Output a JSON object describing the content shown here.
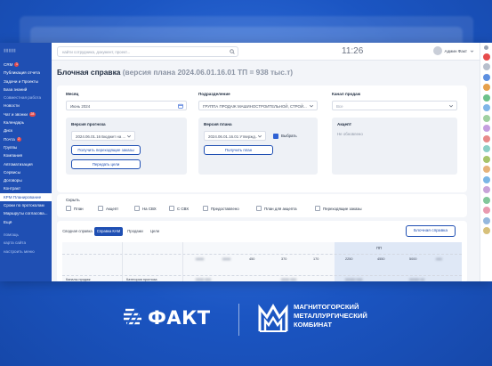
{
  "topbar": {
    "search_placeholder": "найти сотрудника, документ, проект...",
    "clock": "11:26",
    "user_name": "Админ Факт"
  },
  "sidebar": {
    "items": [
      {
        "label": "CRM",
        "badge": "1"
      },
      {
        "label": "Публикация отчета"
      },
      {
        "label": "Задачи и Проекты"
      },
      {
        "label": "База знаний"
      },
      {
        "label": "Совместная работа"
      },
      {
        "label": "Новости"
      },
      {
        "label": "Чат и звонки",
        "badge": "28"
      },
      {
        "label": "Календарь"
      },
      {
        "label": "Диск"
      },
      {
        "label": "Почта",
        "badge": "2"
      },
      {
        "label": "Группы"
      },
      {
        "label": "Компания"
      },
      {
        "label": "Автоматизация"
      },
      {
        "label": "Сервисы"
      },
      {
        "label": "Договоры"
      },
      {
        "label": "Контракт"
      },
      {
        "label": "КРМ Планирование"
      },
      {
        "label": "Сроки по протоколам"
      },
      {
        "label": "Маршруты согласова..."
      },
      {
        "label": "Ещё"
      },
      {
        "label": "помощь"
      },
      {
        "label": "карта сайта"
      },
      {
        "label": "настроить меню"
      }
    ]
  },
  "page": {
    "title": "Блочная справка",
    "subtitle": "(версия плана 2024.06.01.16.01 ТП = 938 тыс.т)"
  },
  "filters": {
    "month_label": "Месяц",
    "month_value": "Июнь 2024",
    "division_label": "Подразделение",
    "division_value": "ГРУППА ПРОДАЖ МАШИНОСТРОИТЕЛЬНОЙ, СТРОЙ...",
    "channel_label": "Канал продаж",
    "channel_value": "Все"
  },
  "forecast": {
    "label": "Версия прогноза",
    "value": "2024.06.01.16 Бюджет на ...",
    "btn_transfer": "Получить переходящие заказы",
    "btn_targets": "Передать цели"
  },
  "plan": {
    "label": "Версия плана",
    "value": "2024.06.01.16.01 Утвержд...",
    "select_label": "Выбрать",
    "btn_get_plan": "Получить план"
  },
  "accept": {
    "label": "Акцепт",
    "value": "Не обновлено"
  },
  "hide": {
    "label": "Скрыть",
    "options": [
      {
        "label": "План"
      },
      {
        "label": "Акцепт"
      },
      {
        "label": "На СВХ"
      },
      {
        "label": "С СВХ"
      },
      {
        "label": "Предоставлено"
      },
      {
        "label": "План для акцепта"
      },
      {
        "label": "Переходящие заказы"
      }
    ]
  },
  "tabs": [
    {
      "label": "Сводная справка"
    },
    {
      "label": "Справка КАМ"
    },
    {
      "label": "Продажи"
    },
    {
      "label": "Цели"
    }
  ],
  "block_report_button": "Блочная справка",
  "table": {
    "group_header": "ПП",
    "values": [
      "450",
      "370",
      "170",
      "2250",
      "4550",
      "5000"
    ],
    "row_label_1": "Каналы продаж",
    "row_label_2": "Категория прогноза"
  },
  "brand": {
    "fakt": "ФАКТ",
    "mmk_line1": "МАГНИТОГОРСКИЙ",
    "mmk_line2": "МЕТАЛЛУРГИЧЕСКИЙ",
    "mmk_line3": "КОМБИНАТ"
  },
  "colors": {
    "brand_blue": "#1f4fb3",
    "background": "#1e5bc6"
  }
}
